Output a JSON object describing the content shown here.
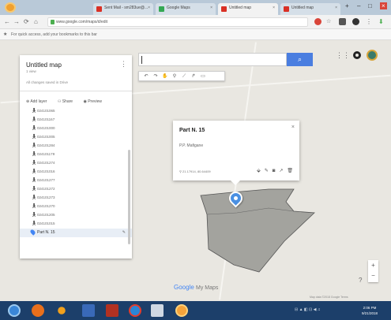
{
  "browser": {
    "tabs": [
      {
        "label": "Sent Mail - sm283ue@...",
        "color": "#d93025"
      },
      {
        "label": "Google Maps",
        "color": "#34a853"
      },
      {
        "label": "Untitled map",
        "color": "#d93025"
      },
      {
        "label": "Untitled map",
        "color": "#d93025"
      }
    ],
    "address": "www.google.com/maps/d/edit",
    "bookmarks_hint": "For quick access, add your bookmarks to this bar"
  },
  "panel": {
    "map_title": "Untitled map",
    "views": "1 view",
    "saved": "All changes saved in Drive",
    "actions": {
      "add_layer": "Add layer",
      "share": "Share",
      "preview": "Preview"
    },
    "items": [
      "024101065",
      "024101167",
      "024101000",
      "024101005",
      "024101284",
      "024101179",
      "024101274",
      "024101016",
      "024101277",
      "024101272",
      "024101273",
      "024101270",
      "024101205",
      "024101015"
    ],
    "selected_item": "Part N. 15"
  },
  "popup": {
    "title": "Part N. 15",
    "owner": "P.P. Mafigane",
    "coords": "21.17914, 80.64409"
  },
  "map": {
    "logo": "Google",
    "logo_suffix": "My Maps",
    "footer": "Map data ©2018 Google   Terms",
    "polygon_color": "#a3a39e"
  },
  "taskbar": {
    "time": "2:06 PM",
    "date": "9/21/2018"
  }
}
